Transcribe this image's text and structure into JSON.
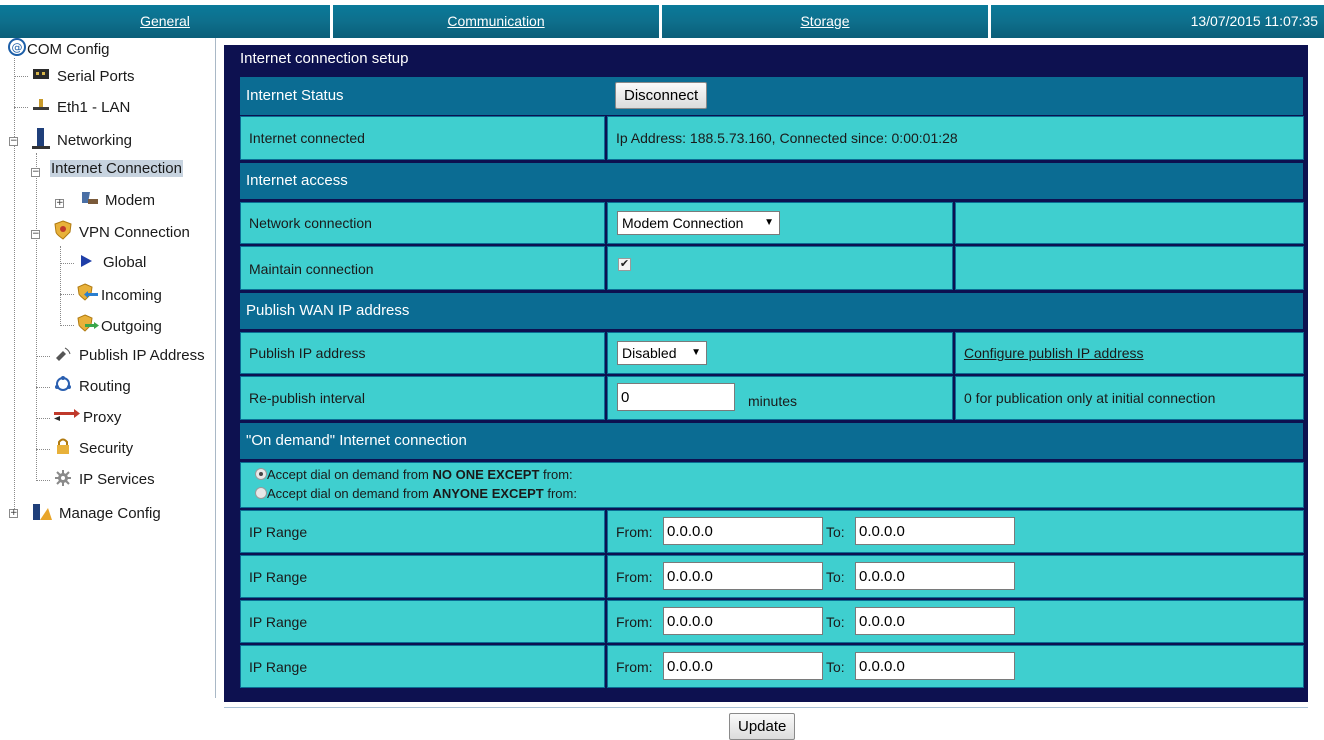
{
  "topbar": {
    "tabs": [
      "General",
      "Communication",
      "Storage"
    ],
    "datetime": "13/07/2015 11:07:35"
  },
  "tree": {
    "root": "COM Config",
    "serial_ports": "Serial Ports",
    "eth1": "Eth1 - LAN",
    "networking": "Networking",
    "internet_connection": "Internet Connection",
    "modem": "Modem",
    "vpn": "VPN Connection",
    "global": "Global",
    "incoming": "Incoming",
    "outgoing": "Outgoing",
    "publish_ip": "Publish IP Address",
    "routing": "Routing",
    "proxy": "Proxy",
    "security": "Security",
    "ip_services": "IP Services",
    "manage_config": "Manage Config"
  },
  "panel": {
    "title": "Internet connection setup",
    "status": {
      "header": "Internet Status",
      "disconnect_label": "Disconnect",
      "row_label": "Internet connected",
      "row_value": "Ip Address: 188.5.73.160, Connected since: 0:00:01:28"
    },
    "access": {
      "header": "Internet access",
      "network_label": "Network connection",
      "network_value": "Modem Connection",
      "maintain_label": "Maintain connection",
      "maintain_checked": true
    },
    "publish": {
      "header": "Publish WAN IP address",
      "publish_label": "Publish IP address",
      "publish_value": "Disabled",
      "configure_link": "Configure publish IP address",
      "republish_label": "Re-publish interval",
      "republish_value": "0",
      "republish_unit": "minutes",
      "republish_note": "0 for publication only at initial connection"
    },
    "ondemand": {
      "header": "\"On demand\" Internet connection",
      "radio1_prefix": "Accept dial on demand from ",
      "radio1_bold": "NO ONE EXCEPT",
      "radio1_suffix": " from:",
      "radio2_prefix": "Accept dial on demand from ",
      "radio2_bold": "ANYONE EXCEPT",
      "radio2_suffix": " from:",
      "from_label": "From:",
      "to_label": "To:",
      "ranges": [
        {
          "label": "IP Range",
          "from": "0.0.0.0",
          "to": "0.0.0.0"
        },
        {
          "label": "IP Range",
          "from": "0.0.0.0",
          "to": "0.0.0.0"
        },
        {
          "label": "IP Range",
          "from": "0.0.0.0",
          "to": "0.0.0.0"
        },
        {
          "label": "IP Range",
          "from": "0.0.0.0",
          "to": "0.0.0.0"
        }
      ]
    },
    "update_label": "Update"
  }
}
